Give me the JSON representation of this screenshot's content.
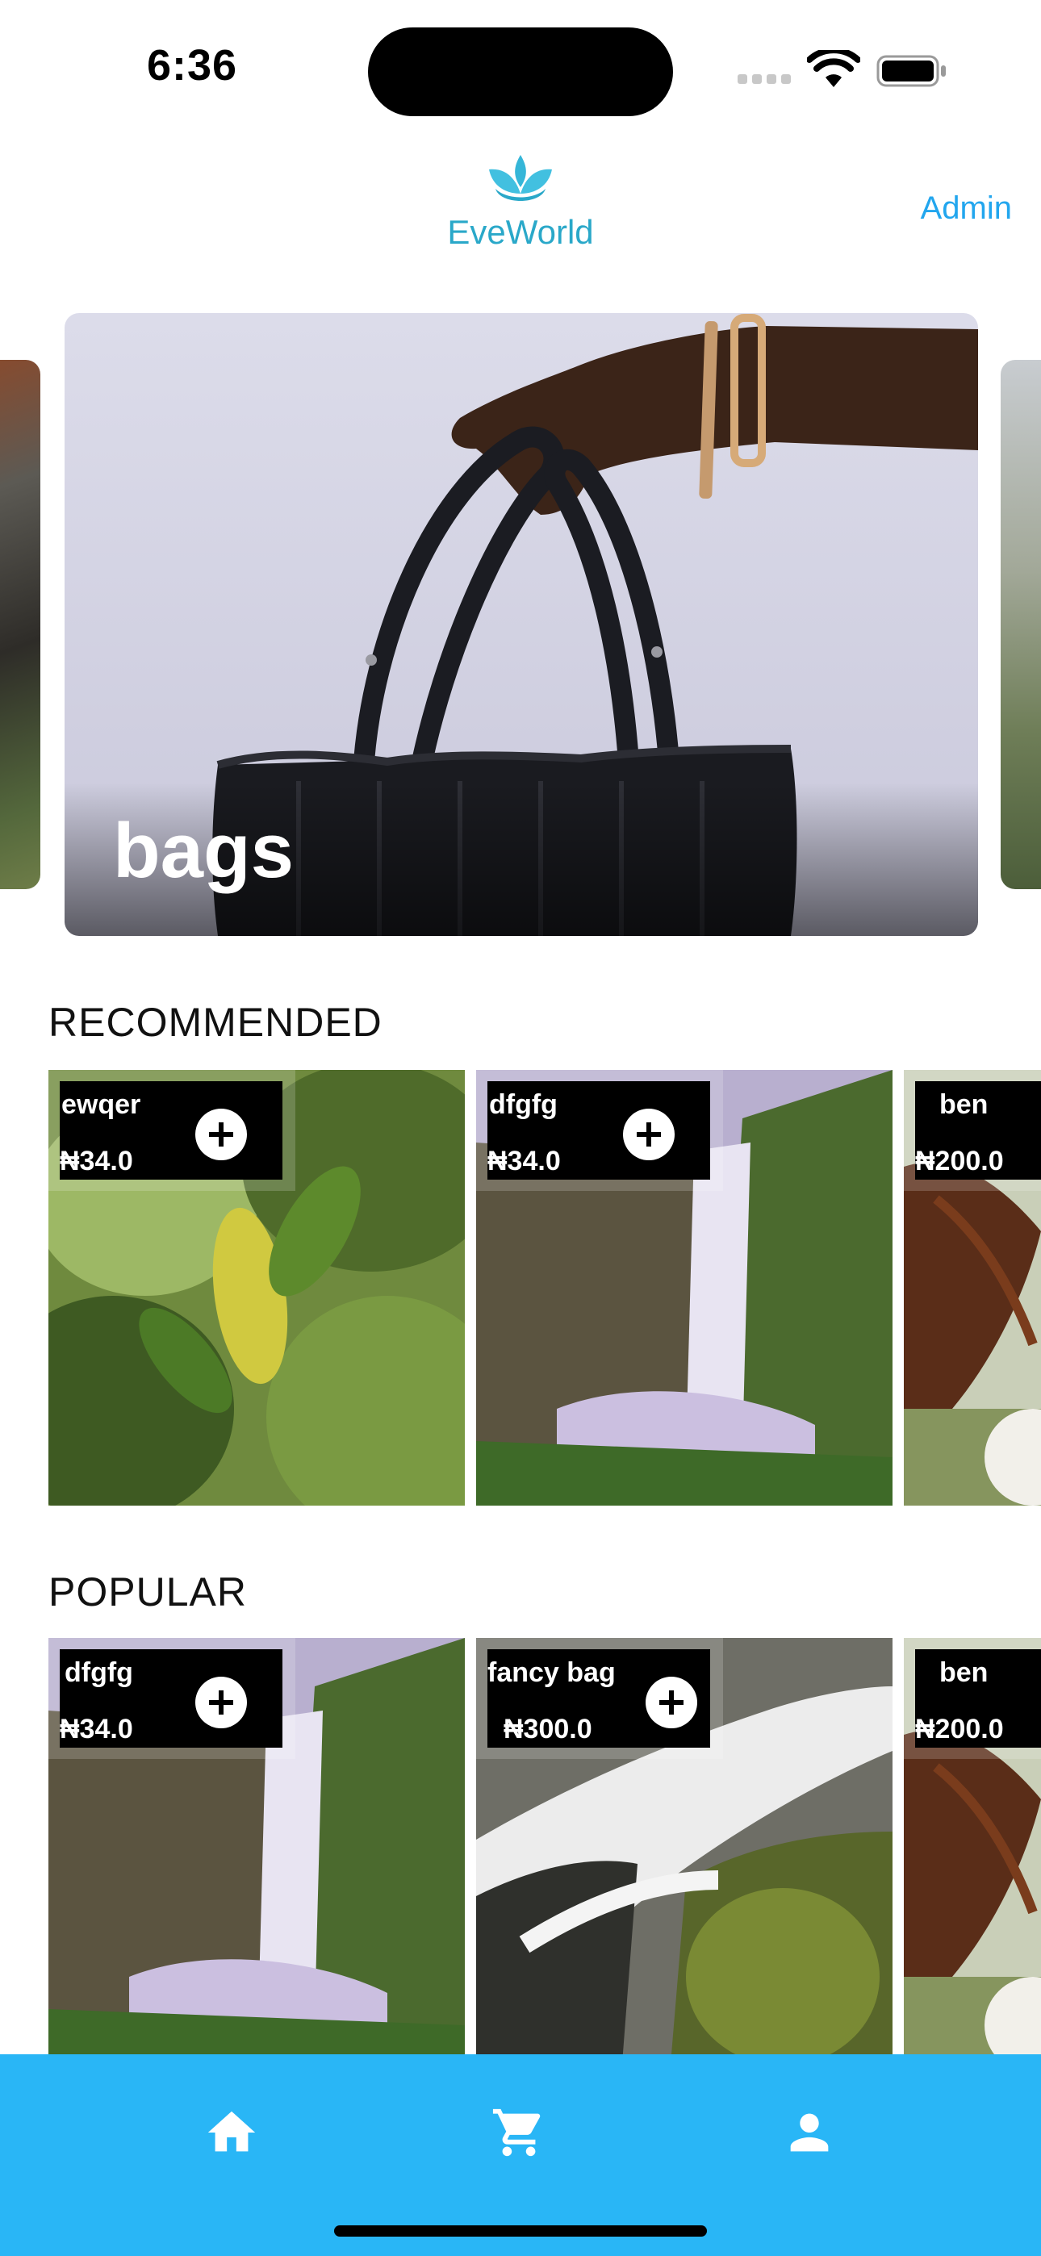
{
  "status_bar": {
    "time": "6:36"
  },
  "header": {
    "brand": "EveWorld",
    "admin_label": "Admin",
    "brand_color": "#2aa8c9",
    "link_color": "#22a6ee"
  },
  "carousel": {
    "current": {
      "title": "bags"
    }
  },
  "sections": {
    "recommended": {
      "title": "RECOMMENDED",
      "items": [
        {
          "name": "ewqer",
          "price": "₦34.0"
        },
        {
          "name": "dfgfg",
          "price": "₦34.0"
        },
        {
          "name": "ben",
          "price": "₦200.0"
        }
      ]
    },
    "popular": {
      "title": "POPULAR",
      "items": [
        {
          "name": "dfgfg",
          "price": "₦34.0"
        },
        {
          "name": "fancy bag",
          "price": "₦300.0"
        },
        {
          "name": "ben",
          "price": "₦200.0"
        }
      ]
    }
  },
  "bottom_nav": {
    "items": [
      {
        "icon": "home-icon"
      },
      {
        "icon": "cart-icon"
      },
      {
        "icon": "person-icon"
      }
    ],
    "color": "#29b6f6"
  }
}
